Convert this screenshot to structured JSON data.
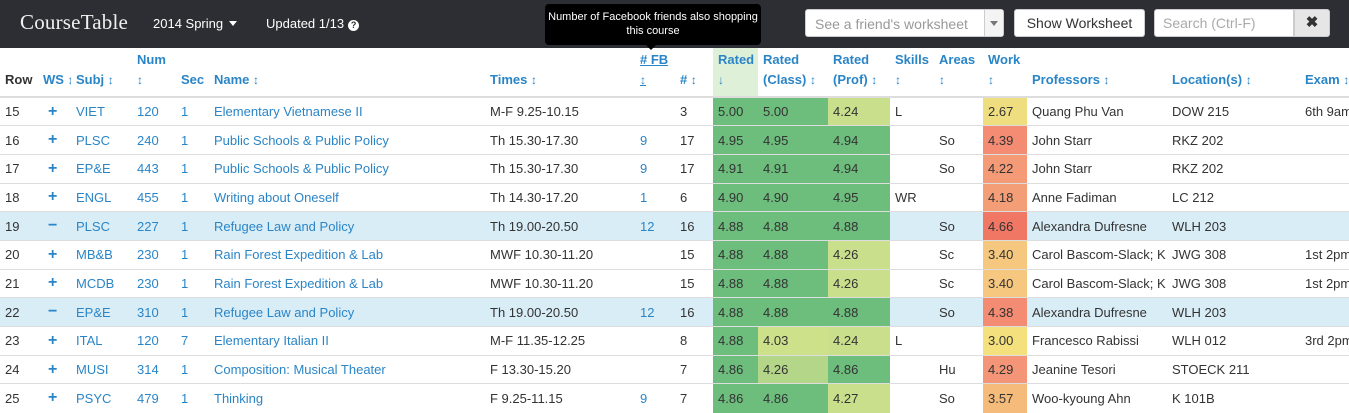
{
  "navbar": {
    "brand": "CourseTable",
    "term": "2014 Spring",
    "updated": "Updated 1/13",
    "friend_select_placeholder": "See a friend's worksheet",
    "show_worksheet_label": "Show Worksheet",
    "search_placeholder": "Search (Ctrl-F)",
    "clear_label": "✖"
  },
  "tooltip": {
    "text": "Number of Facebook friends also shopping this course"
  },
  "colors": {
    "navbar_bg": "#2d2e33",
    "link": "#2a85c7",
    "worksheet_row": "#d9edf7",
    "rating_high": "#6dbd7d",
    "rating_mid": "#a5d187",
    "rating_low": "#c9df8b"
  },
  "table": {
    "headers": [
      {
        "key": "row",
        "line1": "",
        "line2": "Row",
        "sort": ""
      },
      {
        "key": "ws",
        "line1": "",
        "line2": "WS",
        "sort": "↕"
      },
      {
        "key": "subj",
        "line1": "",
        "line2": "Subj",
        "sort": "↕"
      },
      {
        "key": "num",
        "line1": "Num",
        "line2": "",
        "sort": "↕"
      },
      {
        "key": "sec",
        "line1": "",
        "line2": "Sec",
        "sort": ""
      },
      {
        "key": "name",
        "line1": "",
        "line2": "Name",
        "sort": "↕"
      },
      {
        "key": "times",
        "line1": "",
        "line2": "Times",
        "sort": "↕"
      },
      {
        "key": "fb",
        "line1": "# FB",
        "line2": "",
        "sort": "↕"
      },
      {
        "key": "count",
        "line1": "",
        "line2": "#",
        "sort": "↕"
      },
      {
        "key": "rated",
        "line1": "Rated",
        "line2": "",
        "sort": "↓"
      },
      {
        "key": "rated_class",
        "line1": "Rated",
        "line2": "(Class)",
        "sort": "↕"
      },
      {
        "key": "rated_prof",
        "line1": "Rated",
        "line2": "(Prof)",
        "sort": "↕"
      },
      {
        "key": "skills",
        "line1": "Skills",
        "line2": "",
        "sort": "↕"
      },
      {
        "key": "areas",
        "line1": "Areas",
        "line2": "",
        "sort": "↕"
      },
      {
        "key": "work",
        "line1": "Work",
        "line2": "",
        "sort": "↕"
      },
      {
        "key": "professors",
        "line1": "",
        "line2": "Professors",
        "sort": "↕"
      },
      {
        "key": "location",
        "line1": "",
        "line2": "Location(s)",
        "sort": "↕"
      },
      {
        "key": "exam",
        "line1": "",
        "line2": "Exam",
        "sort": "↕"
      }
    ],
    "rows": [
      {
        "row": "15",
        "ws": "+",
        "in_ws": false,
        "subj": "VIET",
        "num": "120",
        "sec": "1",
        "name": "Elementary Vietnamese II",
        "times": "M-F 9.25-10.15",
        "fb": "",
        "count": "3",
        "rated": "5.00",
        "rated_color": "#6dbd7d",
        "rated_class": "5.00",
        "rated_class_color": "#6dbd7d",
        "rated_prof": "4.24",
        "rated_prof_color": "#c9df8b",
        "skills": "L",
        "areas": "",
        "work": "2.67",
        "work_color": "#eede80",
        "professors": "Quang Phu Van",
        "location": "DOW 215",
        "exam": "6th 9am"
      },
      {
        "row": "16",
        "ws": "+",
        "in_ws": false,
        "subj": "PLSC",
        "num": "240",
        "sec": "1",
        "name": "Public Schools & Public Policy",
        "times": "Th 15.30-17.30",
        "fb": "9",
        "count": "17",
        "rated": "4.95",
        "rated_color": "#6dbd7d",
        "rated_class": "4.95",
        "rated_class_color": "#6dbd7d",
        "rated_prof": "4.94",
        "rated_prof_color": "#6dbd7d",
        "skills": "",
        "areas": "So",
        "work": "4.39",
        "work_color": "#f48c73",
        "professors": "John Starr",
        "location": "RKZ 202",
        "exam": ""
      },
      {
        "row": "17",
        "ws": "+",
        "in_ws": false,
        "subj": "EP&E",
        "num": "443",
        "sec": "1",
        "name": "Public Schools & Public Policy",
        "times": "Th 15.30-17.30",
        "fb": "9",
        "count": "17",
        "rated": "4.91",
        "rated_color": "#6dbd7d",
        "rated_class": "4.91",
        "rated_class_color": "#6dbd7d",
        "rated_prof": "4.94",
        "rated_prof_color": "#6dbd7d",
        "skills": "",
        "areas": "So",
        "work": "4.22",
        "work_color": "#f49a77",
        "professors": "John Starr",
        "location": "RKZ 202",
        "exam": ""
      },
      {
        "row": "18",
        "ws": "+",
        "in_ws": false,
        "subj": "ENGL",
        "num": "455",
        "sec": "1",
        "name": "Writing about Oneself",
        "times": "Th 14.30-17.20",
        "fb": "1",
        "count": "6",
        "rated": "4.90",
        "rated_color": "#6dbd7d",
        "rated_class": "4.90",
        "rated_class_color": "#6dbd7d",
        "rated_prof": "4.95",
        "rated_prof_color": "#6dbd7d",
        "skills": "WR",
        "areas": "",
        "work": "4.18",
        "work_color": "#f49e78",
        "professors": "Anne Fadiman",
        "location": "LC 212",
        "exam": ""
      },
      {
        "row": "19",
        "ws": "−",
        "in_ws": true,
        "subj": "PLSC",
        "num": "227",
        "sec": "1",
        "name": "Refugee Law and Policy",
        "times": "Th 19.00-20.50",
        "fb": "12",
        "count": "16",
        "rated": "4.88",
        "rated_color": "#6dbd7d",
        "rated_class": "4.88",
        "rated_class_color": "#6dbd7d",
        "rated_prof": "4.88",
        "rated_prof_color": "#6dbd7d",
        "skills": "",
        "areas": "So",
        "work": "4.66",
        "work_color": "#f17765",
        "professors": "Alexandra Dufresne",
        "location": "WLH 203",
        "exam": ""
      },
      {
        "row": "20",
        "ws": "+",
        "in_ws": false,
        "subj": "MB&B",
        "num": "230",
        "sec": "1",
        "name": "Rain Forest Expedition & Lab",
        "times": "MWF 10.30-11.20",
        "fb": "",
        "count": "15",
        "rated": "4.88",
        "rated_color": "#6dbd7d",
        "rated_class": "4.88",
        "rated_class_color": "#6dbd7d",
        "rated_prof": "4.26",
        "rated_prof_color": "#c9df8b",
        "skills": "",
        "areas": "Sc",
        "work": "3.40",
        "work_color": "#f6c77e",
        "professors": "Carol Bascom-Slack; K",
        "location": "JWG 308",
        "exam": "1st 2pm"
      },
      {
        "row": "21",
        "ws": "+",
        "in_ws": false,
        "subj": "MCDB",
        "num": "230",
        "sec": "1",
        "name": "Rain Forest Expedition & Lab",
        "times": "MWF 10.30-11.20",
        "fb": "",
        "count": "15",
        "rated": "4.88",
        "rated_color": "#6dbd7d",
        "rated_class": "4.88",
        "rated_class_color": "#6dbd7d",
        "rated_prof": "4.26",
        "rated_prof_color": "#c9df8b",
        "skills": "",
        "areas": "Sc",
        "work": "3.40",
        "work_color": "#f6c77e",
        "professors": "Carol Bascom-Slack; K",
        "location": "JWG 308",
        "exam": "1st 2pm"
      },
      {
        "row": "22",
        "ws": "−",
        "in_ws": true,
        "subj": "EP&E",
        "num": "310",
        "sec": "1",
        "name": "Refugee Law and Policy",
        "times": "Th 19.00-20.50",
        "fb": "12",
        "count": "16",
        "rated": "4.88",
        "rated_color": "#6dbd7d",
        "rated_class": "4.88",
        "rated_class_color": "#6dbd7d",
        "rated_prof": "4.88",
        "rated_prof_color": "#6dbd7d",
        "skills": "",
        "areas": "So",
        "work": "4.38",
        "work_color": "#f48c73",
        "professors": "Alexandra Dufresne",
        "location": "WLH 203",
        "exam": ""
      },
      {
        "row": "23",
        "ws": "+",
        "in_ws": false,
        "subj": "ITAL",
        "num": "120",
        "sec": "7",
        "name": "Elementary Italian II",
        "times": "M-F 11.35-12.25",
        "fb": "",
        "count": "8",
        "rated": "4.88",
        "rated_color": "#6dbd7d",
        "rated_class": "4.03",
        "rated_class_color": "#cde08a",
        "rated_prof": "4.24",
        "rated_prof_color": "#c9df8b",
        "skills": "L",
        "areas": "",
        "work": "3.00",
        "work_color": "#f5e07e",
        "professors": "Francesco Rabissi",
        "location": "WLH 012",
        "exam": "3rd 2pm"
      },
      {
        "row": "24",
        "ws": "+",
        "in_ws": false,
        "subj": "MUSI",
        "num": "314",
        "sec": "1",
        "name": "Composition: Musical Theater",
        "times": "F 13.30-15.20",
        "fb": "",
        "count": "7",
        "rated": "4.86",
        "rated_color": "#6dbd7d",
        "rated_class": "4.26",
        "rated_class_color": "#b4d688",
        "rated_prof": "4.86",
        "rated_prof_color": "#6dbd7d",
        "skills": "",
        "areas": "Hu",
        "work": "4.29",
        "work_color": "#f49577",
        "professors": "Jeanine Tesori",
        "location": "STOECK 211",
        "exam": ""
      },
      {
        "row": "25",
        "ws": "+",
        "in_ws": false,
        "subj": "PSYC",
        "num": "479",
        "sec": "1",
        "name": "Thinking",
        "times": "F 9.25-11.15",
        "fb": "9",
        "count": "7",
        "rated": "4.86",
        "rated_color": "#6dbd7d",
        "rated_class": "4.86",
        "rated_class_color": "#6dbd7d",
        "rated_prof": "4.27",
        "rated_prof_color": "#c9df8b",
        "skills": "",
        "areas": "So",
        "work": "3.57",
        "work_color": "#f5bb7b",
        "professors": "Woo-kyoung Ahn",
        "location": "K 101B",
        "exam": ""
      }
    ]
  }
}
